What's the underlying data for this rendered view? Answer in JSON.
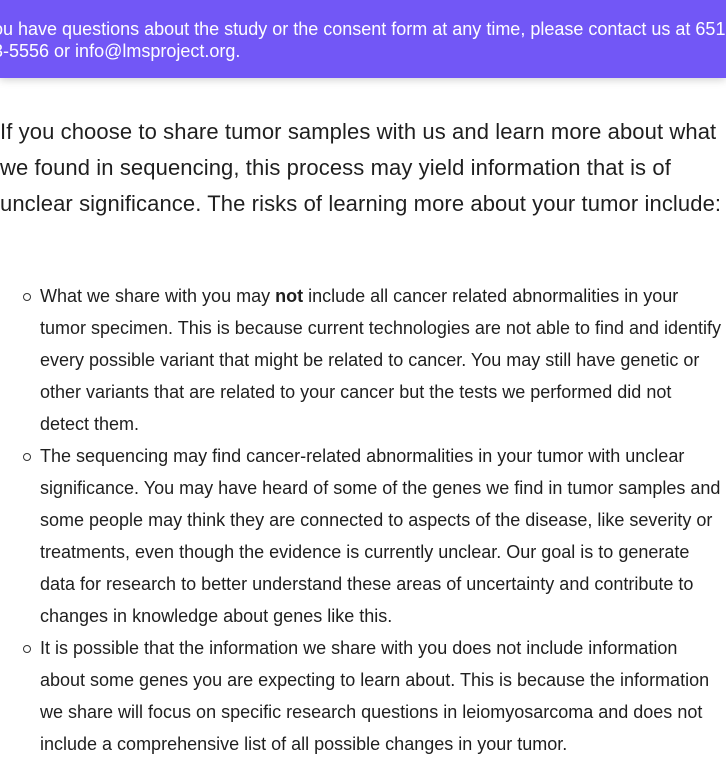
{
  "banner": {
    "line1": "ou have questions about the study or the consent form at any time, please contact us at 651-",
    "line2": "3-5556 or info@lmsproject.org."
  },
  "intro": "If you choose to share tumor samples with us and learn more about what we found in sequencing, this process may yield information that is of unclear significance. The risks of learning more about your tumor include:",
  "risks": [
    {
      "before": "What we share with you may ",
      "bold": "not",
      "after": " include all cancer related abnormalities in your tumor specimen. This is because current technologies are not able to find and identify every possible variant that might be related to cancer. You may still have genetic or other variants that are related to your cancer but the tests we performed did not detect them."
    },
    {
      "text": "The sequencing may find cancer-related abnormalities in your tumor with unclear significance. You may have heard of some of the genes we find in tumor samples and some people may think they are connected to aspects of the disease, like severity or treatments, even though the evidence is currently unclear. Our goal is to generate data for research to better understand these areas of uncertainty and contribute to changes in knowledge about genes like this."
    },
    {
      "text": "It is possible that the information we share with you does not include information about some genes you are expecting to learn about. This is because the information we share will focus on specific research questions in leiomyosarcoma and does not include a comprehensive list of all possible changes in your tumor."
    }
  ],
  "colors": {
    "banner_bg": "#7257f6",
    "banner_text": "#ffffff",
    "body_text": "#1f1f1f"
  }
}
